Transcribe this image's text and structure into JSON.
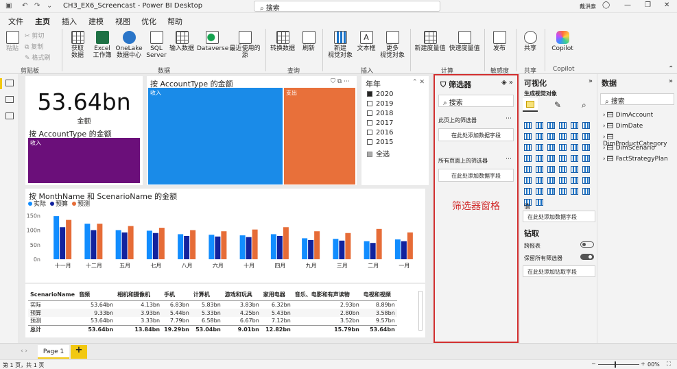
{
  "titlebar": {
    "title": "CH3_EX6_Screencast - Power BI Desktop",
    "search": "搜索",
    "user": "戴洪泰"
  },
  "menus": [
    "文件",
    "主页",
    "插入",
    "建模",
    "视图",
    "优化",
    "帮助"
  ],
  "ribbon": {
    "clipboard": {
      "paste": "粘贴",
      "cut": "剪切",
      "copy": "复制",
      "format_painter": "格式刷",
      "group": "剪贴板"
    },
    "data": {
      "get_data": "获取\n数据",
      "excel": "Excel\n工作簿",
      "onelake": "OneLake\n数据中心",
      "sql": "SQL\nServer",
      "enter_data": "输入数据",
      "dataverse": "Dataverse",
      "recent": "最近使用的\n源",
      "group": "数据"
    },
    "query": {
      "transform": "转换数据",
      "refresh": "刷新",
      "group": "查询"
    },
    "insert": {
      "new_visual": "新建\n视觉对象",
      "textbox": "文本框",
      "more_visuals": "更多\n视觉对象",
      "group": "插入"
    },
    "calc": {
      "new_measure": "新建度量值",
      "quick_measure": "快速度量值",
      "group": "计算"
    },
    "sensitivity": {
      "group": "敏感度"
    },
    "share": {
      "publish": "发布",
      "share": "共享",
      "group": "共享"
    },
    "copilot": {
      "label": "Copilot",
      "group": "Copilot"
    }
  },
  "kpi": {
    "value": "53.64bn",
    "label": "金额"
  },
  "account_small": {
    "title": "按 AccountType 的金额",
    "label": "收入",
    "color": "#6b0f7a"
  },
  "account_big": {
    "title": "按 AccountType 的金额",
    "income": "收入",
    "expense": "支出",
    "income_color": "#1a8be8",
    "expense_color": "#e8703a"
  },
  "slicer": {
    "title": "年年",
    "items": [
      {
        "label": "2020",
        "checked": true
      },
      {
        "label": "2019",
        "checked": false
      },
      {
        "label": "2018",
        "checked": false
      },
      {
        "label": "2017",
        "checked": false
      },
      {
        "label": "2016",
        "checked": false
      },
      {
        "label": "2015",
        "checked": false
      },
      {
        "label": "全选",
        "checked": false
      }
    ]
  },
  "chart_data": {
    "type": "bar",
    "title": "按 MonthName 和 ScenarioName 的金额",
    "categories": [
      "十一月",
      "十二月",
      "五月",
      "七月",
      "八月",
      "六月",
      "十月",
      "四月",
      "九月",
      "三月",
      "二月",
      "一月"
    ],
    "series": [
      {
        "name": "实际",
        "color": "#118dff",
        "values": [
          148,
          122,
          100,
          98,
          86,
          84,
          82,
          86,
          72,
          70,
          62,
          68
        ]
      },
      {
        "name": "预算",
        "color": "#12239e",
        "values": [
          110,
          100,
          92,
          90,
          80,
          78,
          76,
          80,
          66,
          64,
          56,
          62
        ]
      },
      {
        "name": "预测",
        "color": "#e66c37",
        "values": [
          135,
          122,
          114,
          108,
          100,
          96,
          102,
          110,
          96,
          90,
          104,
          92
        ]
      }
    ],
    "yticks": [
      "150n",
      "100n",
      "50n",
      "0n"
    ],
    "ylim": [
      0,
      160
    ]
  },
  "table": {
    "headers": [
      "ScenarioName",
      "音频",
      "相机和摄像机",
      "手机",
      "计算机",
      "游戏和玩具",
      "家用电器",
      "音乐、电影和有声读物",
      "电视和视频"
    ],
    "rows": [
      [
        "实际",
        "53.64bn",
        "4.13bn",
        "6.83bn",
        "5.83bn",
        "3.83bn",
        "6.32bn",
        "2.93bn",
        "8.89bn"
      ],
      [
        "预算",
        "9.33bn",
        "3.93bn",
        "5.44bn",
        "5.33bn",
        "4.25bn",
        "5.43bn",
        "2.80bn",
        "3.58bn"
      ],
      [
        "预测",
        "53.64bn",
        "3.33bn",
        "7.79bn",
        "6.58bn",
        "6.67bn",
        "7.12bn",
        "3.52bn",
        "9.57bn"
      ]
    ],
    "total": [
      "总计",
      "53.64bn",
      "13.84bn",
      "19.29bn",
      "53.04bn",
      "9.01bn",
      "12.82bn",
      "15.79bn",
      "53.64bn"
    ]
  },
  "filters": {
    "title": "筛选器",
    "search": "搜索",
    "this_page": "此页上的筛选器",
    "add_here": "在此处添加数据字段",
    "all_pages": "所有页面上的筛选器",
    "add_here2": "在此处添加数据字段",
    "annotation": "筛选器窗格"
  },
  "viz": {
    "title": "可视化",
    "build": "生成视觉对象",
    "value": "值",
    "add_value": "在此处添加数据字段",
    "drill": "钻取",
    "cross_report": "跨报表",
    "keep_filters": "保留所有筛选器",
    "add_drill": "在此处添加钻取字段"
  },
  "datapane": {
    "title": "数据",
    "search": "搜索",
    "tables": [
      "DimAccount",
      "DimDate",
      "DimProductCategory",
      "DimScenario",
      "FactStrategyPlan"
    ]
  },
  "pages": {
    "tab": "Page 1",
    "add": "+"
  },
  "status": {
    "page": "第 1 页，共 1 页",
    "zoom": "00%"
  }
}
